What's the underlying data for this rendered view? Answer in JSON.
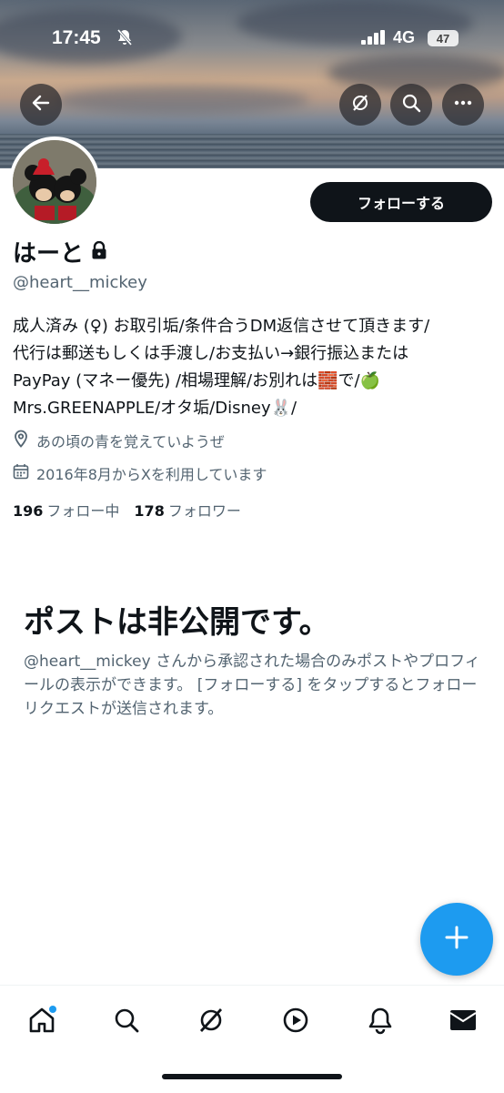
{
  "status_bar": {
    "time": "17:45",
    "network": "4G",
    "battery": "47"
  },
  "profile": {
    "display_name": "はーと",
    "handle": "@heart__mickey",
    "bio_lines": [
      "成人済み (♀) お取引垢/条件合うDM返信させて頂きます/",
      "代行は郵送もしくは手渡し/お支払い→銀行振込または",
      "PayPay (マネー優先) /相場理解/お別れは🧱で/🍏",
      "Mrs.GREENAPPLE/オタ垢/Disney🐰/"
    ],
    "location": "あの頃の青を覚えていようぜ",
    "joined": "2016年8月からXを利用しています",
    "following_count": "196",
    "following_label": "フォロー中",
    "followers_count": "178",
    "followers_label": "フォロワー"
  },
  "follow_button_label": "フォローする",
  "private_notice": {
    "title": "ポストは非公開です。",
    "body": "@heart__mickey さんから承認された場合のみポストやプロフィールの表示ができます。 [フォローする] をタップするとフォローリクエストが送信されます。"
  },
  "icons": {
    "header": [
      "back-arrow-icon",
      "grok-icon",
      "search-icon",
      "more-icon"
    ],
    "tabs": [
      "home-icon",
      "search-icon",
      "grok-icon",
      "video-icon",
      "bell-icon",
      "mail-icon"
    ],
    "fab": "plus-icon"
  },
  "colors": {
    "accent": "#1d9bf0",
    "text": "#0f1419",
    "secondary": "#536471",
    "button": "#0f1419"
  }
}
